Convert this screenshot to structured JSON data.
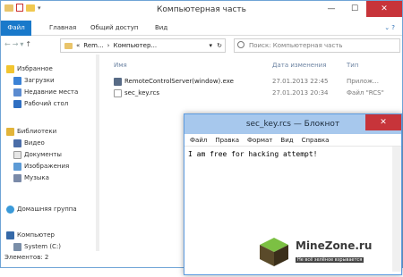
{
  "explorer": {
    "title": "Компьютерная часть",
    "ribbon_tabs": [
      "Файл",
      "Главная",
      "Общий доступ",
      "Вид"
    ],
    "nav_arrows": [
      "←",
      "→",
      "▾",
      "↑"
    ],
    "address": {
      "chevron": "«",
      "crumb1": "Rem...",
      "sep": "›",
      "crumb2": "Компьютер...",
      "dropdown": "▾"
    },
    "refresh": "↻",
    "search": {
      "placeholder": "Поиск: Компьютерная часть"
    },
    "columns": {
      "name": "Имя",
      "date": "Дата изменения",
      "type": "Тип"
    },
    "files": [
      {
        "name": "RemoteControlServer(window).exe",
        "date": "27.01.2013 22:45",
        "type": "Прилож..."
      },
      {
        "name": "sec_key.rcs",
        "date": "27.01.2013 20:34",
        "type": "Файл \"RCS\""
      }
    ],
    "nav": {
      "favorites": "Избранное",
      "downloads": "Загрузки",
      "recent": "Недавние места",
      "desktop": "Рабочий стол",
      "libraries": "Библиотеки",
      "video": "Видео",
      "documents": "Документы",
      "images": "Изображения",
      "music": "Музыка",
      "homegroup": "Домашняя группа",
      "computer": "Компьютер",
      "system": "System (C:)"
    },
    "status": "Элементов: 2",
    "window_controls": {
      "min": "—",
      "max": "☐",
      "close": "✕"
    }
  },
  "notepad": {
    "title": "sec_key.rcs — Блокнот",
    "menu": [
      "Файл",
      "Правка",
      "Формат",
      "Вид",
      "Справка"
    ],
    "content": "I am free for hacking attempt!",
    "close": "✕"
  },
  "watermark": {
    "site": "MineZone.ru",
    "tagline": "Не всё зелёное взрывается"
  },
  "colors": {
    "file_tab": "#1979ca",
    "close": "#c7343a",
    "notepad_title": "#a7c8ed",
    "link": "#6d84a3"
  }
}
